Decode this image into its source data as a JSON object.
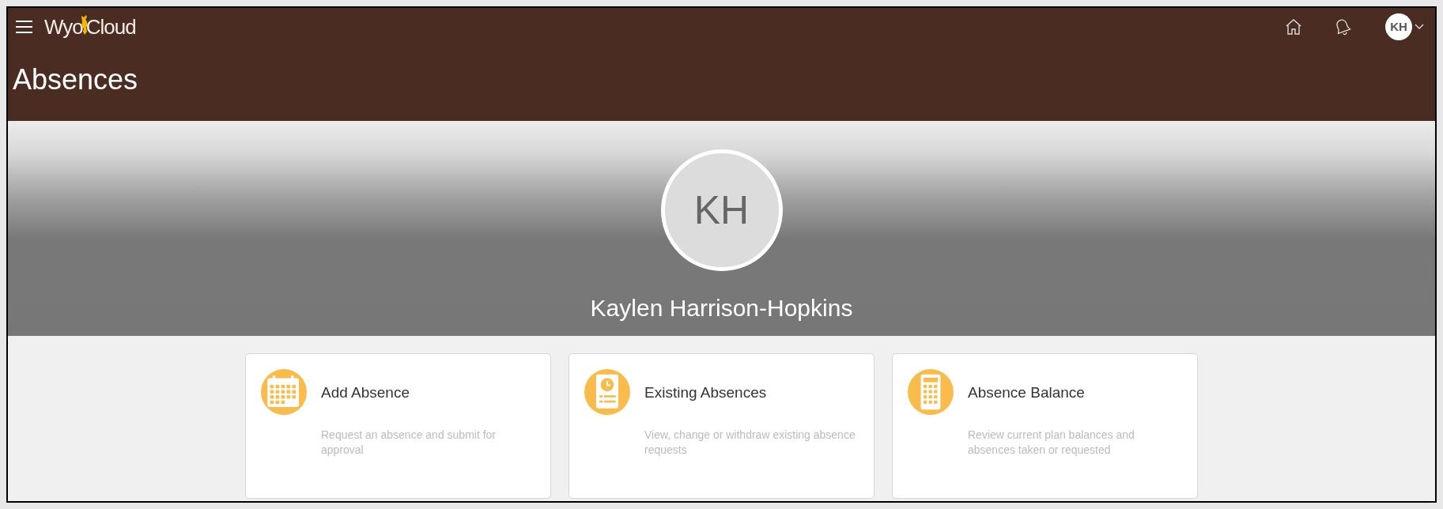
{
  "header": {
    "logo_parts": [
      "Wyo",
      "Cloud"
    ],
    "user_initials": "KH"
  },
  "page_title": "Absences",
  "profile": {
    "initials": "KH",
    "name": "Kaylen Harrison-Hopkins"
  },
  "cards": [
    {
      "kind": "calendar",
      "title": "Add Absence",
      "description": "Request an absence and submit for approval"
    },
    {
      "kind": "document",
      "title": "Existing Absences",
      "description": "View, change or withdraw existing absence requests"
    },
    {
      "kind": "calculator",
      "title": "Absence Balance",
      "description": "Review current plan balances and absences taken or requested"
    }
  ]
}
